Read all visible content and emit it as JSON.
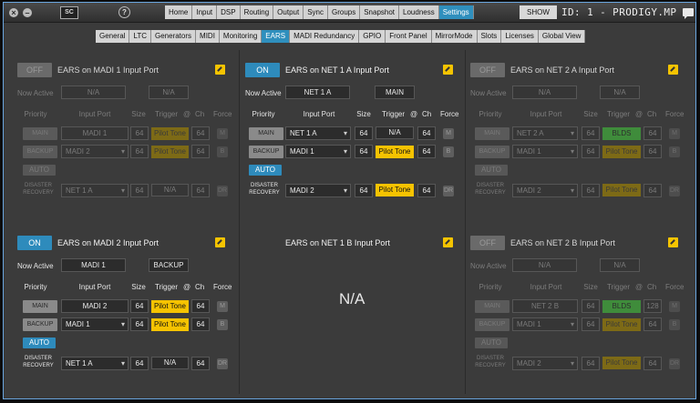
{
  "toolbar": {
    "sc_badge": "SC",
    "help": "?",
    "menu": [
      "Home",
      "Input",
      "DSP",
      "Routing",
      "Output",
      "Sync",
      "Groups",
      "Snapshot",
      "Loudness",
      "Settings"
    ],
    "active_menu": "Settings",
    "show": "SHOW",
    "ident": "ID: 1 - PRODIGY.MP"
  },
  "subtabs": [
    "General",
    "LTC",
    "Generators",
    "MIDI",
    "Monitoring",
    "EARS",
    "MADI Redundancy",
    "GPIO",
    "Front Panel",
    "MirrorMode",
    "Slots",
    "Licenses",
    "Global View"
  ],
  "active_subtab": "EARS",
  "labels": {
    "now_active": "Now Active",
    "priority": "Priority",
    "input_port": "Input Port",
    "size": "Size",
    "trigger": "Trigger",
    "at": "@",
    "ch": "Ch",
    "force": "Force",
    "auto": "AUTO",
    "disaster1": "DISASTER",
    "disaster2": "RECOVERY",
    "main": "MAIN",
    "backup": "BACKUP",
    "m": "M",
    "b": "B",
    "dr": "DR"
  },
  "ports": [
    {
      "state": "OFF",
      "title": "EARS on MADI 1 Input Port",
      "now_active": "N/A",
      "now_active2": "N/A",
      "main": {
        "port": "MADI 1",
        "size": "64",
        "trigger": "Pilot Tone",
        "ch": "64"
      },
      "backup": {
        "port": "MADI 2",
        "size": "64",
        "trigger": "Pilot Tone",
        "ch": "64"
      },
      "dr": {
        "port": "NET 1 A",
        "size": "64",
        "trigger": "N/A",
        "ch": "64"
      }
    },
    {
      "state": "ON",
      "title": "EARS on NET 1 A Input Port",
      "now_active": "NET 1 A",
      "now_active2": "MAIN",
      "main": {
        "port": "NET 1 A",
        "size": "64",
        "trigger": "N/A",
        "ch": "64"
      },
      "backup": {
        "port": "MADI 1",
        "size": "64",
        "trigger": "Pilot Tone",
        "ch": "64"
      },
      "dr": {
        "port": "MADI 2",
        "size": "64",
        "trigger": "Pilot Tone",
        "ch": "64"
      }
    },
    {
      "state": "OFF",
      "title": "EARS on NET 2 A Input Port",
      "now_active": "N/A",
      "now_active2": "N/A",
      "main": {
        "port": "NET 2 A",
        "size": "64",
        "trigger": "BLDS",
        "ch": "64"
      },
      "backup": {
        "port": "MADI 1",
        "size": "64",
        "trigger": "Pilot Tone",
        "ch": "64"
      },
      "dr": {
        "port": "MADI 2",
        "size": "64",
        "trigger": "Pilot Tone",
        "ch": "64"
      }
    },
    {
      "state": "ON",
      "title": "EARS on MADI 2 Input Port",
      "now_active": "MADI 1",
      "now_active2": "BACKUP",
      "main": {
        "port": "MADI 2",
        "size": "64",
        "trigger": "Pilot Tone",
        "ch": "64"
      },
      "backup": {
        "port": "MADI 1",
        "size": "64",
        "trigger": "Pilot Tone",
        "ch": "64"
      },
      "dr": {
        "port": "NET 1 A",
        "size": "64",
        "trigger": "N/A",
        "ch": "64"
      }
    },
    {
      "title": "EARS on NET 1 B Input Port",
      "na": "N/A"
    },
    {
      "state": "OFF",
      "title": "EARS on NET 2 B Input Port",
      "now_active": "N/A",
      "now_active2": "N/A",
      "main": {
        "port": "NET 2 B",
        "size": "64",
        "trigger": "BLDS",
        "ch": "128"
      },
      "backup": {
        "port": "MADI 1",
        "size": "64",
        "trigger": "Pilot Tone",
        "ch": "64"
      },
      "dr": {
        "port": "MADI 2",
        "size": "64",
        "trigger": "Pilot Tone",
        "ch": "64"
      }
    }
  ]
}
